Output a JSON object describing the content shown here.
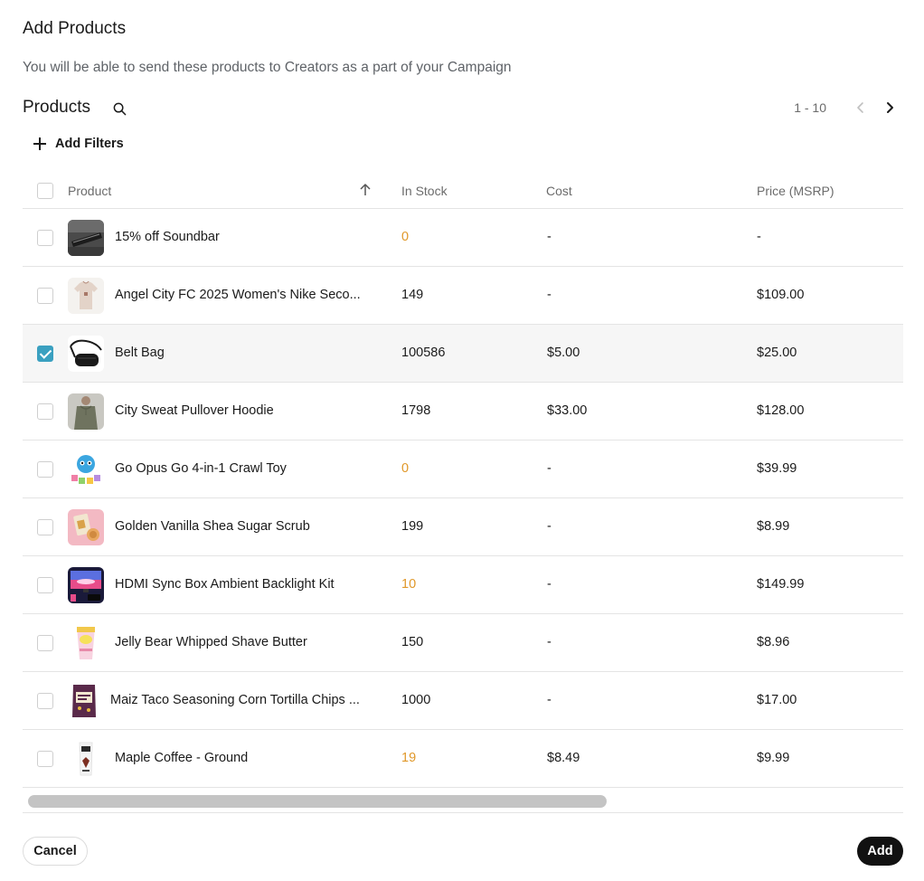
{
  "modal": {
    "title": "Add Products",
    "subtitle": "You will be able to send these products to Creators as a part of your Campaign"
  },
  "products_section": {
    "title": "Products",
    "search_icon": "search-icon",
    "pagination": {
      "range": "1 - 10",
      "prev_icon": "chevron-left-icon",
      "next_icon": "chevron-right-icon"
    },
    "add_filters_label": "Add Filters"
  },
  "table": {
    "columns": {
      "product": "Product",
      "in_stock": "In Stock",
      "cost": "Cost",
      "price": "Price (MSRP)"
    },
    "sort": {
      "column": "Product",
      "direction": "ascending"
    },
    "rows": [
      {
        "name": "15% off Soundbar",
        "in_stock": "0",
        "cost": "-",
        "price": "-",
        "selected": false,
        "stock_warning": true
      },
      {
        "name": "Angel City FC 2025 Women's Nike Seco...",
        "in_stock": "149",
        "cost": "-",
        "price": "$109.00",
        "selected": false,
        "stock_warning": false
      },
      {
        "name": "Belt Bag",
        "in_stock": "100586",
        "cost": "$5.00",
        "price": "$25.00",
        "selected": true,
        "stock_warning": false
      },
      {
        "name": "City Sweat Pullover Hoodie",
        "in_stock": "1798",
        "cost": "$33.00",
        "price": "$128.00",
        "selected": false,
        "stock_warning": false
      },
      {
        "name": "Go Opus Go 4-in-1 Crawl Toy",
        "in_stock": "0",
        "cost": "-",
        "price": "$39.99",
        "selected": false,
        "stock_warning": true
      },
      {
        "name": "Golden Vanilla Shea Sugar Scrub",
        "in_stock": "199",
        "cost": "-",
        "price": "$8.99",
        "selected": false,
        "stock_warning": false
      },
      {
        "name": "HDMI Sync Box Ambient Backlight Kit",
        "in_stock": "10",
        "cost": "-",
        "price": "$149.99",
        "selected": false,
        "stock_warning": true
      },
      {
        "name": "Jelly Bear Whipped Shave Butter",
        "in_stock": "150",
        "cost": "-",
        "price": "$8.96",
        "selected": false,
        "stock_warning": false
      },
      {
        "name": "Maiz Taco Seasoning Corn Tortilla Chips ...",
        "in_stock": "1000",
        "cost": "-",
        "price": "$17.00",
        "selected": false,
        "stock_warning": false
      },
      {
        "name": "Maple Coffee - Ground",
        "in_stock": "19",
        "cost": "$8.49",
        "price": "$9.99",
        "selected": false,
        "stock_warning": true
      }
    ]
  },
  "footer": {
    "cancel_label": "Cancel",
    "add_label": "Add"
  },
  "colors": {
    "accent_checkbox": "#3aa0c0",
    "stock_warning": "#e0982a",
    "primary_button": "#111111"
  }
}
